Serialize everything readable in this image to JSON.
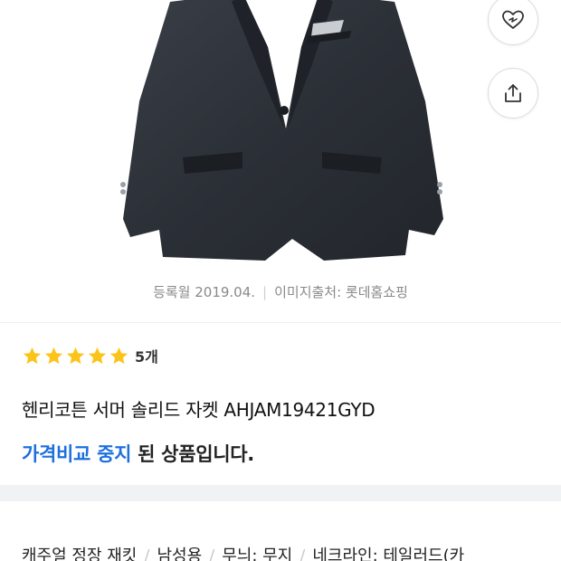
{
  "product": {
    "title": "헨리코튼 서머 솔리드 자켓 AHJAM19421GYD",
    "registered": "등록월 2019.04.",
    "image_source": "이미지출처: 롯데홈쇼핑",
    "rating": 5,
    "review_count": "5개"
  },
  "notice": {
    "highlight": "가격비교 중지",
    "rest": " 된 상품입니다."
  },
  "attributes": [
    "캐주얼 정장 재킷",
    "남성용",
    "무늬: 무지",
    "네크라인: 테일러드(카"
  ],
  "icons": {
    "like": "heart-icon",
    "share": "share-icon",
    "star": "star-icon"
  },
  "colors": {
    "accent_blue": "#1e6fde",
    "star_yellow": "#fcc419",
    "muted_text": "#8a8a8a"
  }
}
